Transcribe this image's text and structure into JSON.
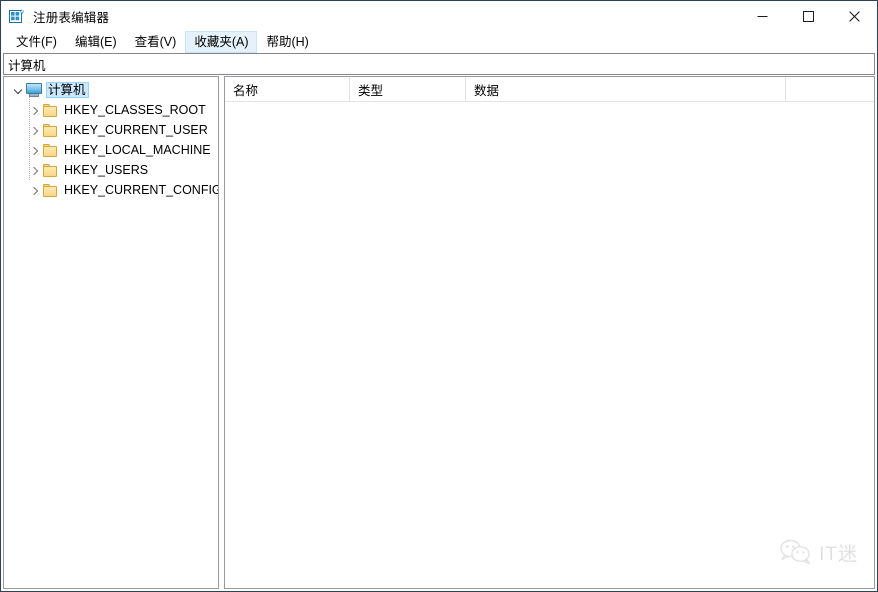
{
  "window": {
    "title": "注册表编辑器",
    "icon": "registry-editor-icon",
    "border_color": "#2b4259",
    "controls": {
      "minimize_label": "—",
      "maximize_label": "□",
      "close_label": "✕",
      "minimize_name": "minimize",
      "maximize_name": "maximize",
      "close_name": "close"
    }
  },
  "menubar": {
    "items": [
      {
        "label": "文件(F)",
        "name": "file",
        "active": false
      },
      {
        "label": "编辑(E)",
        "name": "edit",
        "active": false
      },
      {
        "label": "查看(V)",
        "name": "view",
        "active": false
      },
      {
        "label": "收藏夹(A)",
        "name": "favorites",
        "active": true
      },
      {
        "label": "帮助(H)",
        "name": "help",
        "active": false
      }
    ],
    "highlight_color": "#e5f1fb"
  },
  "address": {
    "value": "计算机",
    "placeholder": ""
  },
  "tree": {
    "root": {
      "label": "计算机",
      "icon": "monitor-icon",
      "expanded": true,
      "selected": true,
      "selection_color": "#cce8ff"
    },
    "children": [
      {
        "label": "HKEY_CLASSES_ROOT",
        "icon": "folder-icon",
        "expanded": false
      },
      {
        "label": "HKEY_CURRENT_USER",
        "icon": "folder-icon",
        "expanded": false
      },
      {
        "label": "HKEY_LOCAL_MACHINE",
        "icon": "folder-icon",
        "expanded": false
      },
      {
        "label": "HKEY_USERS",
        "icon": "folder-icon",
        "expanded": false
      },
      {
        "label": "HKEY_CURRENT_CONFIG",
        "icon": "folder-icon",
        "expanded": false
      }
    ]
  },
  "list": {
    "columns": [
      {
        "label": "名称",
        "name": "name"
      },
      {
        "label": "类型",
        "name": "type"
      },
      {
        "label": "数据",
        "name": "data"
      }
    ],
    "rows": []
  },
  "watermark": {
    "text": "IT迷",
    "logo": "wechat-logo",
    "color": "#b6b6b6"
  }
}
